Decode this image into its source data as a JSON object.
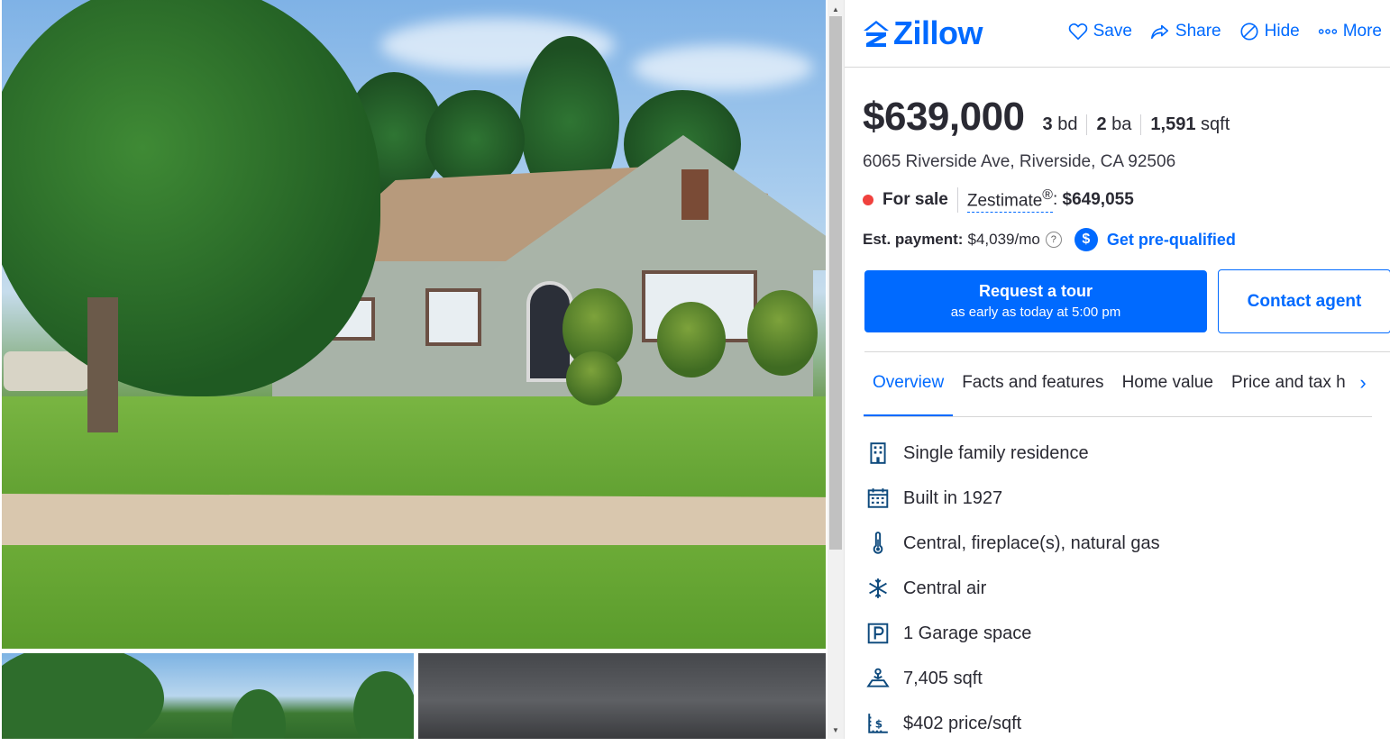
{
  "brand": {
    "name": "Zillow",
    "color": "#006aff"
  },
  "actions": [
    {
      "label": "Save",
      "icon": "heart-icon"
    },
    {
      "label": "Share",
      "icon": "share-icon"
    },
    {
      "label": "Hide",
      "icon": "hide-icon"
    },
    {
      "label": "More",
      "icon": "more-icon"
    }
  ],
  "listing": {
    "price": "$639,000",
    "beds_num": "3",
    "beds_unit": "bd",
    "baths_num": "2",
    "baths_unit": "ba",
    "sqft_num": "1,591",
    "sqft_unit": "sqft",
    "address": "6065 Riverside Ave, Riverside, CA 92506",
    "status": "For sale",
    "zestimate_label": "Zestimate",
    "zestimate_mark": "®",
    "zestimate_value": "$649,055",
    "payment_label": "Est. payment:",
    "payment_value": "$4,039/mo",
    "help": "?",
    "prequal_icon_text": "$",
    "prequal_label": "Get pre-qualified"
  },
  "buttons": {
    "tour_label": "Request a tour",
    "tour_sub": "as early as today at 5:00 pm",
    "contact_label": "Contact agent"
  },
  "tabs": [
    "Overview",
    "Facts and features",
    "Home value",
    "Price and tax h"
  ],
  "features": [
    {
      "icon": "building-icon",
      "text": "Single family residence"
    },
    {
      "icon": "calendar-icon",
      "text": "Built in 1927"
    },
    {
      "icon": "thermometer-icon",
      "text": "Central, fireplace(s), natural gas"
    },
    {
      "icon": "snowflake-icon",
      "text": "Central air"
    },
    {
      "icon": "parking-icon",
      "text": "1 Garage space"
    },
    {
      "icon": "lot-size-icon",
      "text": "7,405 sqft"
    },
    {
      "icon": "price-per-sqft-icon",
      "text": "$402 price/sqft"
    }
  ]
}
